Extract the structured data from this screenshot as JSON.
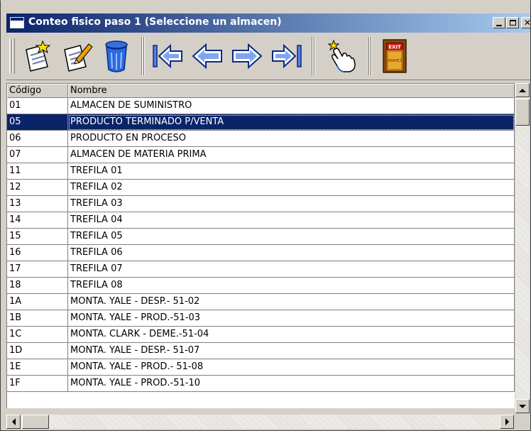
{
  "window": {
    "title": "Conteo fisico paso 1 (Seleccione un almacen)"
  },
  "toolbar": {
    "tools": [
      {
        "name": "new-record-button",
        "icon": "new-document-star-icon"
      },
      {
        "name": "edit-record-button",
        "icon": "edit-document-pencil-icon"
      },
      {
        "name": "delete-record-button",
        "icon": "trash-can-icon"
      },
      {
        "name": "first-record-button",
        "icon": "arrow-first-icon"
      },
      {
        "name": "previous-record-button",
        "icon": "arrow-left-icon"
      },
      {
        "name": "next-record-button",
        "icon": "arrow-right-icon"
      },
      {
        "name": "last-record-button",
        "icon": "arrow-last-icon"
      },
      {
        "name": "select-button",
        "icon": "pointing-hand-icon"
      },
      {
        "name": "exit-button",
        "icon": "exit-door-icon",
        "label": "EXIT"
      }
    ]
  },
  "grid": {
    "columns": [
      "Código",
      "Nombre"
    ],
    "selected_index": 1,
    "rows": [
      {
        "codigo": "01",
        "nombre": "ALMACEN DE SUMINISTRO"
      },
      {
        "codigo": "05",
        "nombre": "PRODUCTO TERMINADO P/VENTA"
      },
      {
        "codigo": "06",
        "nombre": "PRODUCTO EN PROCESO"
      },
      {
        "codigo": "07",
        "nombre": "ALMACEN DE MATERIA PRIMA"
      },
      {
        "codigo": "11",
        "nombre": "TREFILA 01"
      },
      {
        "codigo": "12",
        "nombre": "TREFILA 02"
      },
      {
        "codigo": "13",
        "nombre": "TREFILA 03"
      },
      {
        "codigo": "14",
        "nombre": "TREFILA 04"
      },
      {
        "codigo": "15",
        "nombre": "TREFILA 05"
      },
      {
        "codigo": "16",
        "nombre": "TREFILA 06"
      },
      {
        "codigo": "17",
        "nombre": "TREFILA 07"
      },
      {
        "codigo": "18",
        "nombre": "TREFILA 08"
      },
      {
        "codigo": "1A",
        "nombre": "MONTA. YALE - DESP.- 51-02"
      },
      {
        "codigo": "1B",
        "nombre": "MONTA. YALE - PROD.-51-03"
      },
      {
        "codigo": "1C",
        "nombre": "MONTA. CLARK - DEME.-51-04"
      },
      {
        "codigo": "1D",
        "nombre": "MONTA. YALE - DESP.- 51-07"
      },
      {
        "codigo": "1E",
        "nombre": "MONTA. YALE - PROD.- 51-08"
      },
      {
        "codigo": "1F",
        "nombre": "MONTA. YALE - PROD.-51-10"
      }
    ]
  },
  "colors": {
    "selection": "#0a246a",
    "titlebar_start": "#0a246a",
    "titlebar_end": "#a6caf0",
    "face": "#d4d0c8"
  }
}
